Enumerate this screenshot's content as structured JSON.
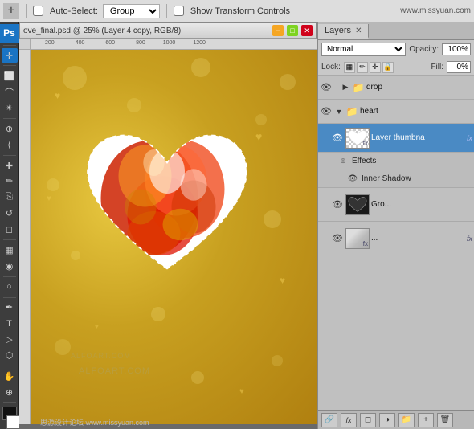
{
  "topbar": {
    "tool_label": "Auto-Select:",
    "group_label": "Group",
    "transform_label": "Show Transform Controls",
    "watermark": "www.missyuan.com",
    "watermark2": "思源设计论坛 www.missyuan.com"
  },
  "document": {
    "title": "ove_final.psd @ 25% (Layer 4 copy, RGB/8)",
    "rulers": [
      "200",
      "400",
      "600",
      "800",
      "1000",
      "1200"
    ]
  },
  "layers": {
    "panel_title": "Layers",
    "close": "✕",
    "blend_mode": "Normal",
    "opacity_label": "Opacity:",
    "opacity_value": "100%",
    "lock_label": "Lock:",
    "fill_label": "Fill:",
    "fill_value": "0%",
    "items": [
      {
        "name": "drop",
        "type": "group",
        "visible": true,
        "expanded": false,
        "indent": 0
      },
      {
        "name": "heart",
        "type": "group",
        "visible": true,
        "expanded": true,
        "indent": 0
      },
      {
        "name": "Layer thumbna",
        "type": "layer",
        "visible": true,
        "selected": true,
        "has_fx": true,
        "thumb_type": "white-heart",
        "indent": 1
      },
      {
        "name": "Effects",
        "type": "effects-header",
        "indent": 2
      },
      {
        "name": "Inner Shadow",
        "type": "effect",
        "visible": true,
        "indent": 2
      },
      {
        "name": "Gro...",
        "type": "layer",
        "visible": true,
        "selected": false,
        "has_fx": false,
        "thumb_type": "black-heart",
        "indent": 1
      },
      {
        "name": "...",
        "type": "layer",
        "visible": true,
        "selected": false,
        "has_fx": true,
        "thumb_type": "light-hand",
        "indent": 1
      }
    ],
    "bottom_buttons": [
      "link",
      "fx",
      "mask",
      "adjustment",
      "group",
      "new",
      "trash"
    ]
  },
  "tools": [
    "move",
    "rect",
    "lasso",
    "magic",
    "crop",
    "slice",
    "heal",
    "brush",
    "clone",
    "history",
    "eraser",
    "gradient",
    "blur",
    "dodge",
    "pen",
    "text",
    "path",
    "shape",
    "eyedrop",
    "hand",
    "zoom"
  ]
}
